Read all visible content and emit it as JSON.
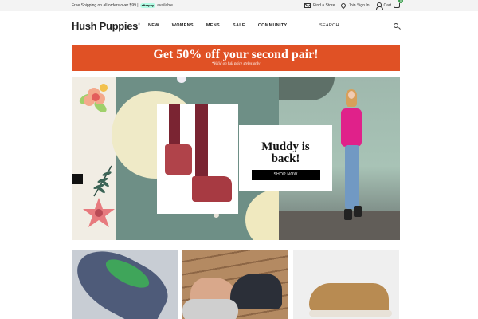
{
  "topbar": {
    "shipping_text": "Free Shipping on all orders over $99 |",
    "afterpay_label": "afterpay",
    "available_text": "available",
    "find_store": "Find a Store",
    "join_signin": "Join  Sign In",
    "cart": "Cart",
    "cart_count": "0"
  },
  "nav": {
    "logo": "Hush Puppies",
    "logo_mark": "®",
    "items": [
      "NEW",
      "WOMENS",
      "MENS",
      "SALE",
      "COMMUNITY"
    ],
    "search_placeholder": "SEARCH"
  },
  "promo": {
    "headline": "Get 50% off your second pair!",
    "subtext": "*Valid on full price styles only"
  },
  "hero": {
    "headline_line1": "Muddy is",
    "headline_line2": "back!",
    "cta": "SHOP NOW"
  },
  "colors": {
    "promo_bg": "#e05125",
    "hero_teal": "#6e8f86",
    "hero_cream": "#efeac7",
    "cta_bg": "#000000",
    "cart_badge": "#3ea04f"
  }
}
